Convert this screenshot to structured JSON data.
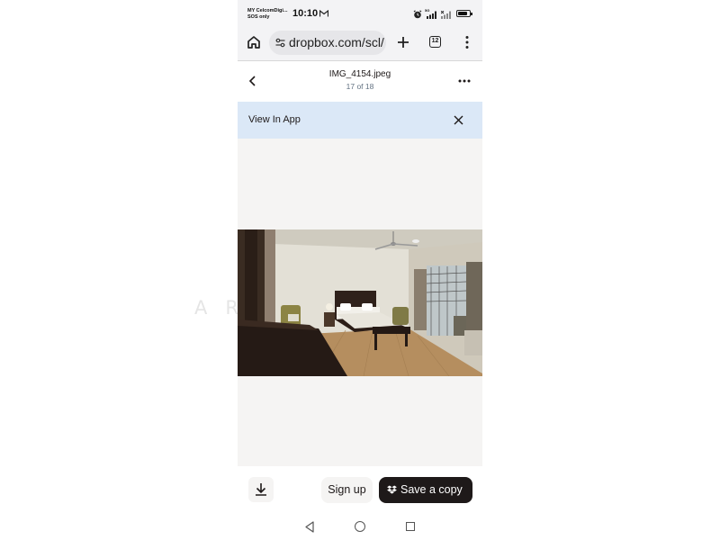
{
  "status_bar": {
    "carrier_line1": "MY CelcomDigi...",
    "carrier_line2": "SOS only",
    "time": "10:10",
    "network_label": "5G",
    "battery_level": 0.8
  },
  "browser": {
    "url": "dropbox.com/scl/",
    "tab_count": "12",
    "icons": [
      "home-icon",
      "tune-icon",
      "plus-icon",
      "tabs-icon",
      "kebab-icon"
    ]
  },
  "viewer_header": {
    "file_name": "IMG_4154.jpeg",
    "position": "17 of 18"
  },
  "banner": {
    "text": "View In App"
  },
  "footer": {
    "sign_up": "Sign up",
    "save_copy": "Save a copy"
  },
  "colors": {
    "dark_button": "#1e1919",
    "banner_bg": "#dbe8f7",
    "viewer_bg": "#f5f4f3"
  },
  "watermark": "ARNIEW"
}
